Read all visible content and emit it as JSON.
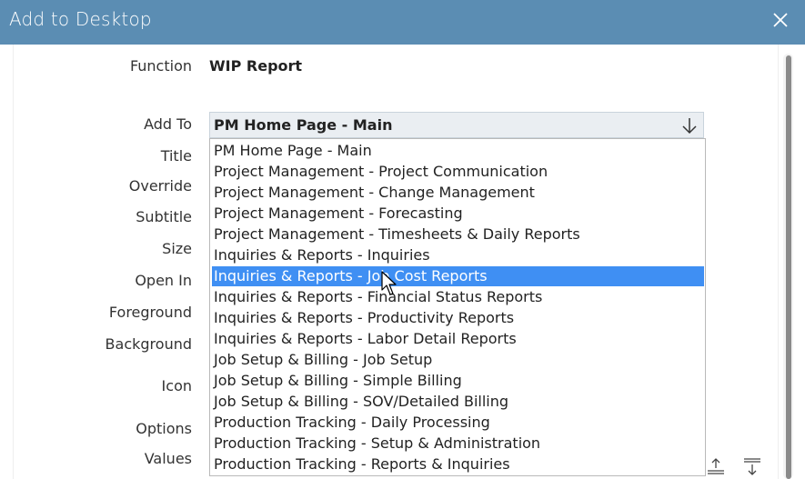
{
  "window": {
    "title": "Add to Desktop",
    "close_icon": "close-icon"
  },
  "form": {
    "labels": {
      "function": "Function",
      "add_to": "Add To",
      "title": "Title",
      "override": "Override",
      "subtitle": "Subtitle",
      "size": "Size",
      "open_in": "Open In",
      "foreground": "Foreground",
      "background": "Background",
      "icon": "Icon",
      "options": "Options",
      "values": "Values"
    },
    "function_value": "WIP Report",
    "add_to_selected": "PM Home Page - Main",
    "add_to_arrow_icon": "arrow-down-icon"
  },
  "dropdown": {
    "selected_index": 6,
    "options": [
      "PM Home Page - Main",
      "Project Management - Project Communication",
      "Project Management - Change Management",
      "Project Management - Forecasting",
      "Project Management - Timesheets & Daily Reports",
      "Inquiries & Reports - Inquiries",
      "Inquiries & Reports - Job Cost Reports",
      "Inquiries & Reports - Financial Status Reports",
      "Inquiries & Reports - Productivity Reports",
      "Inquiries & Reports - Labor Detail Reports",
      "Job Setup & Billing - Job Setup",
      "Job Setup & Billing - Simple Billing",
      "Job Setup & Billing - SOV/Detailed Billing",
      "Production Tracking - Daily Processing",
      "Production Tracking - Setup & Administration",
      "Production Tracking - Reports & Inquiries"
    ]
  },
  "icons": {
    "move_top": "move-to-top-icon",
    "move_bottom": "move-to-bottom-icon",
    "cursor": "mouse-pointer-icon"
  },
  "colors": {
    "titlebar": "#5b8db3",
    "selection": "#3f8ff3",
    "select_bg": "#eaeef2"
  }
}
